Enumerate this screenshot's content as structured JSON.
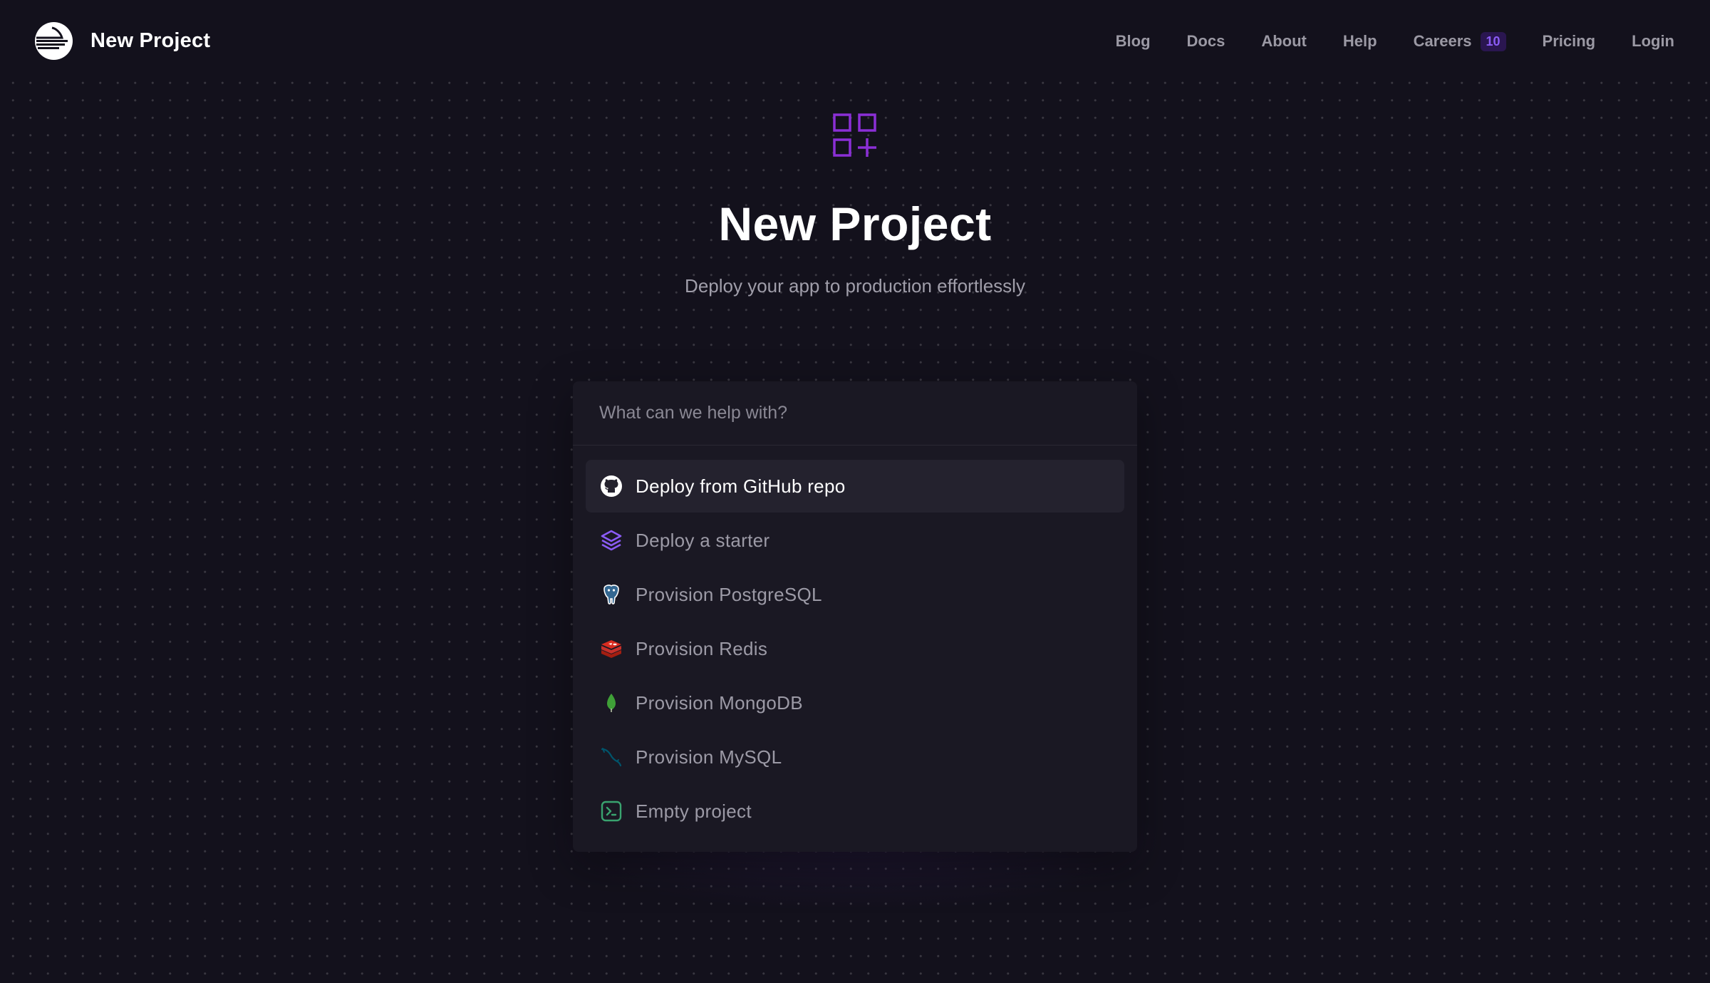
{
  "brand": {
    "name": "New Project",
    "logo_icon": "railway-logo-icon"
  },
  "nav": {
    "links": [
      {
        "label": "Blog"
      },
      {
        "label": "Docs"
      },
      {
        "label": "About"
      },
      {
        "label": "Help"
      },
      {
        "label": "Careers",
        "badge": "10"
      },
      {
        "label": "Pricing"
      },
      {
        "label": "Login"
      }
    ]
  },
  "hero": {
    "icon": "grid-plus-icon",
    "title": "New Project",
    "subtitle": "Deploy your app to production effortlessly"
  },
  "command": {
    "placeholder": "What can we help with?",
    "options": [
      {
        "label": "Deploy from GitHub repo",
        "icon": "github-icon",
        "active": true
      },
      {
        "label": "Deploy a starter",
        "icon": "layers-icon"
      },
      {
        "label": "Provision PostgreSQL",
        "icon": "postgresql-icon"
      },
      {
        "label": "Provision Redis",
        "icon": "redis-icon"
      },
      {
        "label": "Provision MongoDB",
        "icon": "mongodb-icon"
      },
      {
        "label": "Provision MySQL",
        "icon": "mysql-icon"
      },
      {
        "label": "Empty project",
        "icon": "terminal-icon"
      }
    ]
  },
  "colors": {
    "background": "#13111c",
    "panel": "#1a1823",
    "accent": "#8b2fd6",
    "active_row": "#24222e",
    "muted_text": "#9c9aa6"
  }
}
